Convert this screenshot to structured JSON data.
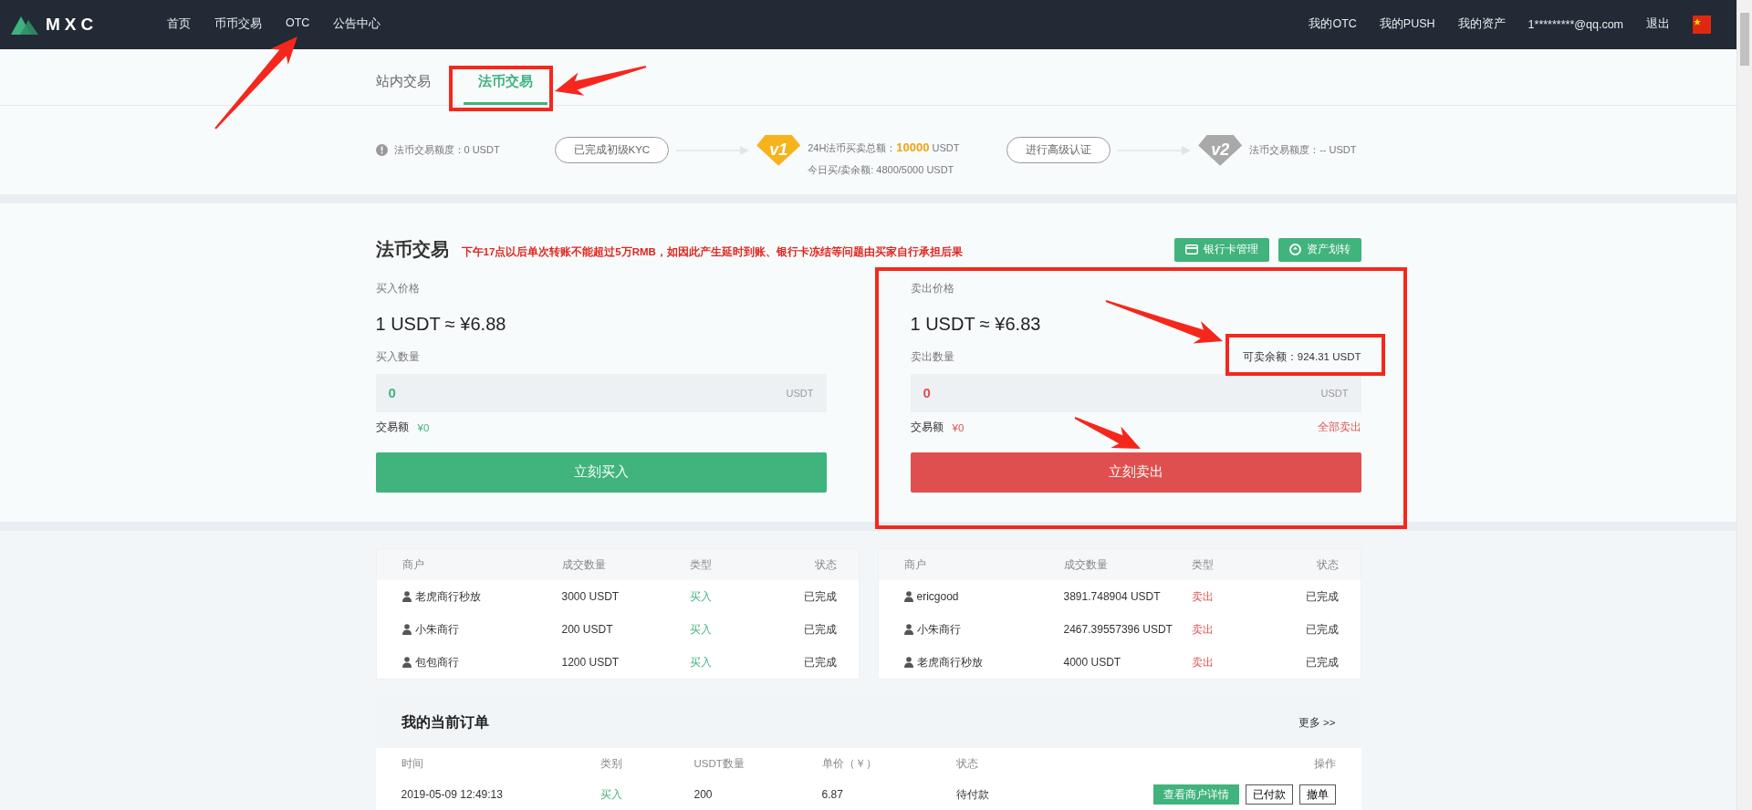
{
  "header": {
    "logo": "MXC",
    "nav": [
      "首页",
      "币币交易",
      "OTC",
      "公告中心"
    ],
    "links": [
      "我的OTC",
      "我的PUSH",
      "我的资产"
    ],
    "email": "1*********@qq.com",
    "logout": "退出"
  },
  "tabs": [
    {
      "label": "站内交易",
      "selected": false
    },
    {
      "label": "法币交易",
      "selected": true
    }
  ],
  "kyc": {
    "quota": "法币交易额度：0 USDT",
    "step1_button": "已完成初级KYC",
    "v1_badge": "v1",
    "v1_total_label": "24H法币买卖总额：",
    "v1_total_value": "10000",
    "v1_total_unit": "USDT",
    "v1_remaining": "今日买/卖余额: 4800/5000 USDT",
    "step2_button": "进行高级认证",
    "v2_badge": "v2",
    "v2_quota": "法币交易额度：-- USDT"
  },
  "trade": {
    "title": "法币交易",
    "notice": "下午17点以后单次转账不能超过5万RMB，如因此产生延时到账、银行卡冻结等问题由买家自行承担后果",
    "buttons": [
      {
        "label": "银行卡管理",
        "kind": "card"
      },
      {
        "label": "资产划转",
        "kind": "transfer"
      }
    ],
    "panels": [
      {
        "kind": "buy",
        "price_label": "买入价格",
        "price": "1 USDT ≈ ¥6.88",
        "amount_label": "买入数量",
        "value": "0",
        "unit": "USDT",
        "total_label": "交易额",
        "total": "¥0",
        "action": "立刻买入"
      },
      {
        "kind": "sell",
        "price_label": "卖出价格",
        "price": "1 USDT ≈ ¥6.83",
        "amount_label": "卖出数量",
        "available": "可卖余额：924.31 USDT",
        "value": "0",
        "unit": "USDT",
        "total_label": "交易额",
        "total": "¥0",
        "sell_all": "全部卖出",
        "action": "立刻卖出"
      }
    ]
  },
  "recent": [
    {
      "columns": [
        "商户",
        "成交数量",
        "类型",
        "状态"
      ],
      "rows": [
        {
          "merchant": "老虎商行秒放",
          "amount": "3000 USDT",
          "type": "买入",
          "kind": "buy",
          "status": "已完成"
        },
        {
          "merchant": "小朱商行",
          "amount": "200 USDT",
          "type": "买入",
          "kind": "buy",
          "status": "已完成"
        },
        {
          "merchant": "包包商行",
          "amount": "1200 USDT",
          "type": "买入",
          "kind": "buy",
          "status": "已完成"
        }
      ]
    },
    {
      "columns": [
        "商户",
        "成交数量",
        "类型",
        "状态"
      ],
      "rows": [
        {
          "merchant": "ericgood",
          "amount": "3891.748904 USDT",
          "type": "卖出",
          "kind": "sell",
          "status": "已完成"
        },
        {
          "merchant": "小朱商行",
          "amount": "2467.39557396 USDT",
          "type": "卖出",
          "kind": "sell",
          "status": "已完成"
        },
        {
          "merchant": "老虎商行秒放",
          "amount": "4000 USDT",
          "type": "卖出",
          "kind": "sell",
          "status": "已完成"
        }
      ]
    }
  ],
  "orders": {
    "title": "我的当前订单",
    "more": "更多 >>",
    "columns": [
      "时间",
      "类别",
      "USDT数量",
      "单价（￥）",
      "状态",
      "操作"
    ],
    "rows": [
      {
        "time": "2019-05-09 12:49:13",
        "type": "买入",
        "kind": "buy",
        "qty": "200",
        "price": "6.87",
        "status": "待付款",
        "actions": [
          {
            "label": "查看商户详情",
            "kind": "primary"
          },
          {
            "label": "已付款",
            "kind": "outline"
          },
          {
            "label": "撤单",
            "kind": "outline"
          }
        ]
      }
    ]
  }
}
